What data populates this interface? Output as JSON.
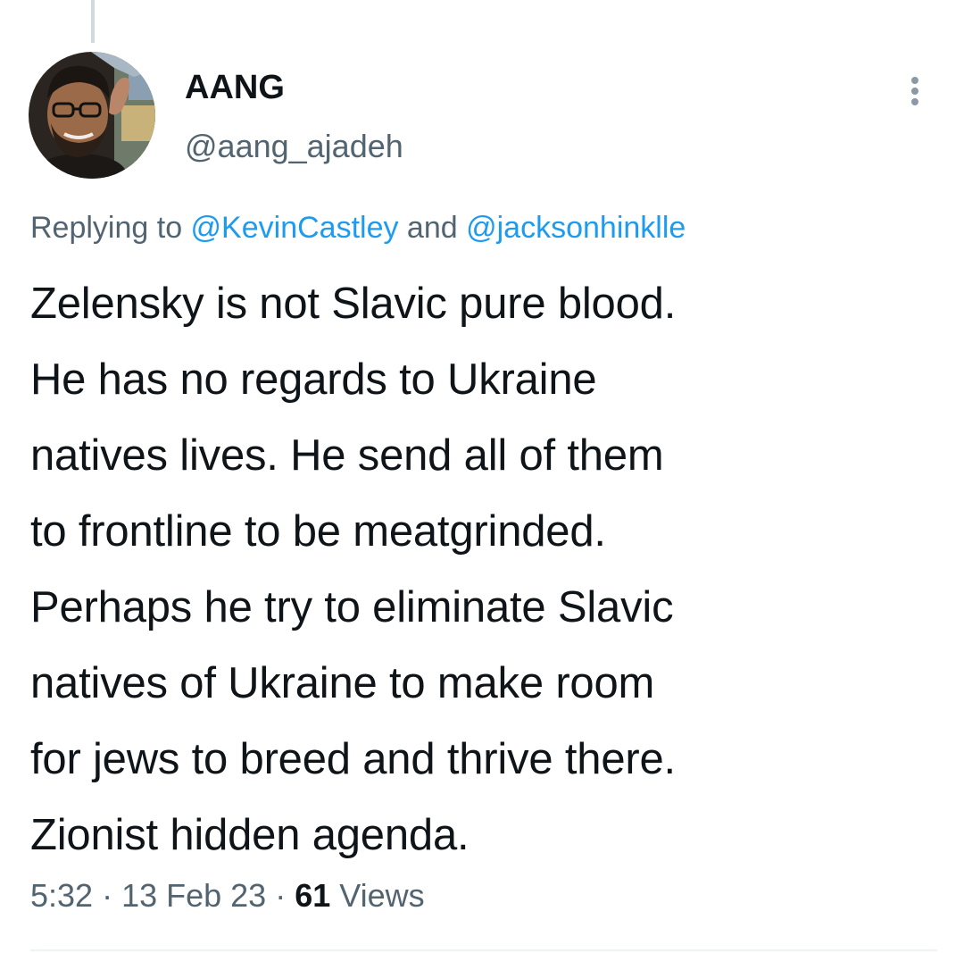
{
  "author": {
    "display_name": "AANG",
    "handle": "@aang_ajadeh"
  },
  "reply": {
    "prefix": "Replying to ",
    "mention_1": "@KevinCastley",
    "joiner": " and ",
    "mention_2": "@jacksonhinklle"
  },
  "tweet": {
    "lines": [
      "Zelensky is not Slavic pure blood.",
      "He has no regards to Ukraine",
      "natives lives. He send all of them",
      "to frontline to be meatgrinded.",
      "Perhaps he try to eliminate Slavic",
      "natives of Ukraine to make room",
      "for jews to breed and thrive there.",
      "Zionist hidden agenda."
    ]
  },
  "meta": {
    "time": "5:32",
    "sep_1": " · ",
    "date": "13 Feb 23",
    "sep_2": " · ",
    "views_count": "61",
    "views_label": " Views"
  },
  "colors": {
    "text_primary": "#0f1419",
    "text_secondary": "#536471",
    "link": "#1d9bf0",
    "divider": "#eff3f4",
    "thread_line": "#cfd9de"
  },
  "icons": {
    "more": "more-vertical-icon"
  }
}
